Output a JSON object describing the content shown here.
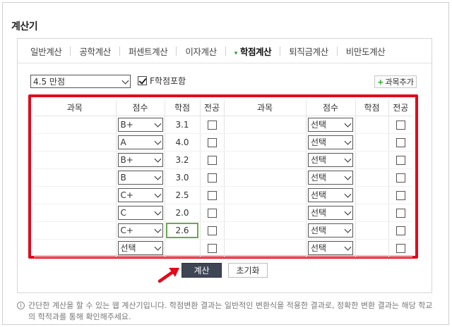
{
  "title": "계산기",
  "tabs": [
    {
      "label": "일반계산",
      "active": false
    },
    {
      "label": "공학계산",
      "active": false
    },
    {
      "label": "퍼센트계산",
      "active": false
    },
    {
      "label": "이자계산",
      "active": false
    },
    {
      "label": "학점계산",
      "active": true
    },
    {
      "label": "퇴직금계산",
      "active": false
    },
    {
      "label": "비만도계산",
      "active": false
    }
  ],
  "scale_select": {
    "value": "4.5 만점"
  },
  "f_include": {
    "label": "F학점포함",
    "checked": true
  },
  "add_course_button": {
    "label": "과목추가"
  },
  "table": {
    "headers": [
      "과목",
      "점수",
      "학점",
      "전공",
      "과목",
      "점수",
      "학점",
      "전공"
    ],
    "left_rows": [
      {
        "subject": "",
        "grade": "B+",
        "credit": "3.1",
        "major": false
      },
      {
        "subject": "",
        "grade": "A",
        "credit": "4.0",
        "major": false
      },
      {
        "subject": "",
        "grade": "B+",
        "credit": "3.2",
        "major": false
      },
      {
        "subject": "",
        "grade": "B",
        "credit": "3.0",
        "major": false
      },
      {
        "subject": "",
        "grade": "C+",
        "credit": "2.5",
        "major": false
      },
      {
        "subject": "",
        "grade": "C",
        "credit": "2.0",
        "major": false
      },
      {
        "subject": "",
        "grade": "C+",
        "credit": "2.6",
        "major": false,
        "editing": true
      },
      {
        "subject": "",
        "grade": "선택",
        "credit": "",
        "major": false
      }
    ],
    "right_rows": [
      {
        "subject": "",
        "grade": "선택",
        "credit": "",
        "major": false
      },
      {
        "subject": "",
        "grade": "선택",
        "credit": "",
        "major": false
      },
      {
        "subject": "",
        "grade": "선택",
        "credit": "",
        "major": false
      },
      {
        "subject": "",
        "grade": "선택",
        "credit": "",
        "major": false
      },
      {
        "subject": "",
        "grade": "선택",
        "credit": "",
        "major": false
      },
      {
        "subject": "",
        "grade": "선택",
        "credit": "",
        "major": false
      },
      {
        "subject": "",
        "grade": "선택",
        "credit": "",
        "major": false
      },
      {
        "subject": "",
        "grade": "선택",
        "credit": "",
        "major": false
      }
    ]
  },
  "calculate_button": {
    "label": "계산"
  },
  "reset_button": {
    "label": "초기화"
  },
  "info_text": "간단한 계산을 할 수 있는 웹 계산기입니다. 학점변환 결과는 일반적인 변환식을 적용한 결과로, 정확한 변환 결과는 해당 학교의 학적과를 통해 확인해주세요.",
  "colors": {
    "highlight_border": "#e3091a",
    "primary_button": "#3e4656",
    "accent": "#2a9d2a"
  }
}
